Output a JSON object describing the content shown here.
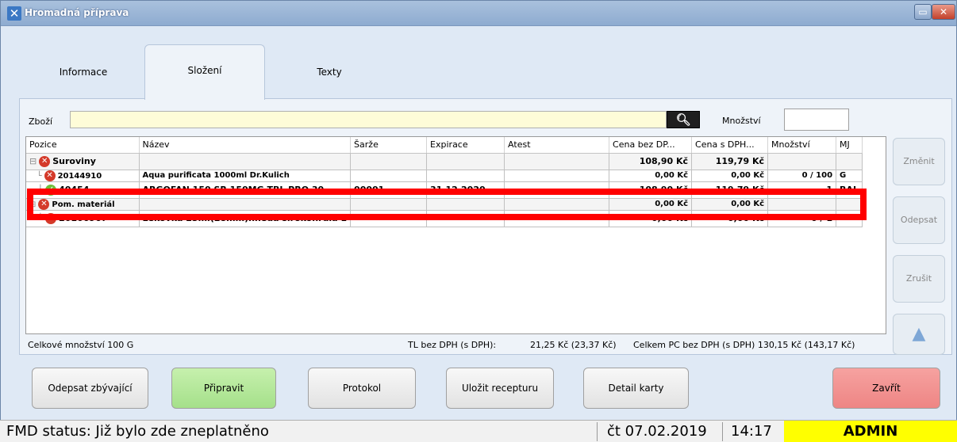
{
  "window": {
    "title": "Hromadná příprava"
  },
  "tabs": [
    {
      "label": "Informace",
      "active": false
    },
    {
      "label": "Složení",
      "active": true
    },
    {
      "label": "Texty",
      "active": false
    }
  ],
  "filter": {
    "zbozi_label": "Zboží",
    "zbozi_value": "",
    "mnozstvi_label": "Množství",
    "mnozstvi_value": ""
  },
  "grid": {
    "columns": [
      "Pozice",
      "Název",
      "Šarže",
      "Expirace",
      "Atest",
      "Cena bez DP...",
      "Cena s DPH...",
      "Množství",
      "MJ"
    ],
    "rows": [
      {
        "type": "group",
        "pozice": "Suroviny",
        "nazev": "",
        "sarze": "",
        "expirace": "",
        "atest": "",
        "cena_bez": "108,90 Kč",
        "cena_s": "119,79 Kč",
        "mnozstvi": "",
        "mj": "",
        "status": "error"
      },
      {
        "type": "item-compressed",
        "pozice": "20144910",
        "nazev": "Aqua purificata 1000ml Dr.Kulich",
        "sarze": "",
        "expirace": "",
        "atest": "",
        "cena_bez": "0,00 Kč",
        "cena_s": "0,00 Kč",
        "mnozstvi": "0 / 100",
        "mj": "G",
        "status": "error"
      },
      {
        "type": "item",
        "pozice": "40454",
        "nazev": "ARGOFAN 150 SR 150MG TBL PRO 30",
        "sarze": "00001",
        "expirace": "31.12.2020",
        "atest": "",
        "cena_bez": "108,90 Kč",
        "cena_s": "119,79 Kč",
        "mnozstvi": "1",
        "mj": "BAL",
        "status": "ok"
      },
      {
        "type": "group-compressed",
        "pozice": "Pom. materiál",
        "nazev": "",
        "sarze": "",
        "expirace": "",
        "atest": "",
        "cena_bez": "0,00 Kč",
        "cena_s": "0,00 Kč",
        "mnozstvi": "",
        "mj": "",
        "status": "error"
      },
      {
        "type": "item",
        "pozice": "20106967",
        "nazev": "Lékovka 23ml(28mm)hnědá širokohrdlá 1",
        "sarze": "",
        "expirace": "",
        "atest": "",
        "cena_bez": "0,00 Kč",
        "cena_s": "0,00 Kč",
        "mnozstvi": "0 / 1",
        "mj": "",
        "status": "error"
      }
    ]
  },
  "summary": {
    "total_qty": "Celkové množství 100 G",
    "tl_label": "TL bez DPH (s DPH):",
    "tl_value": "21,25 Kč (23,37 Kč)",
    "celkem": "Celkem PC bez DPH (s DPH) 130,15 Kč (143,17 Kč)"
  },
  "side_buttons": {
    "zmenit": "Změnit",
    "odepsat": "Odepsat",
    "zrusit": "Zrušit",
    "arrows_icon": "up-down-arrows-icon"
  },
  "bottom_buttons": {
    "odepsat_zbyvajici": "Odepsat zbývající",
    "pripravit": "Připravit",
    "protokol": "Protokol",
    "ulozit_recepturu": "Uložit recepturu",
    "detail_karty": "Detail karty",
    "zavrit": "Zavřít"
  },
  "status_bar": {
    "fmd": "FMD status: Již bylo zde zneplatněno",
    "date": "čt 07.02.2019",
    "time": "14:17",
    "user": "ADMIN"
  },
  "colors": {
    "highlight": "#ff0000",
    "pripravit_bg": "#b4e89b",
    "zavrit_bg": "#f29593",
    "user_bg": "#ffff00",
    "zbozi_bg": "#fefcd8"
  }
}
